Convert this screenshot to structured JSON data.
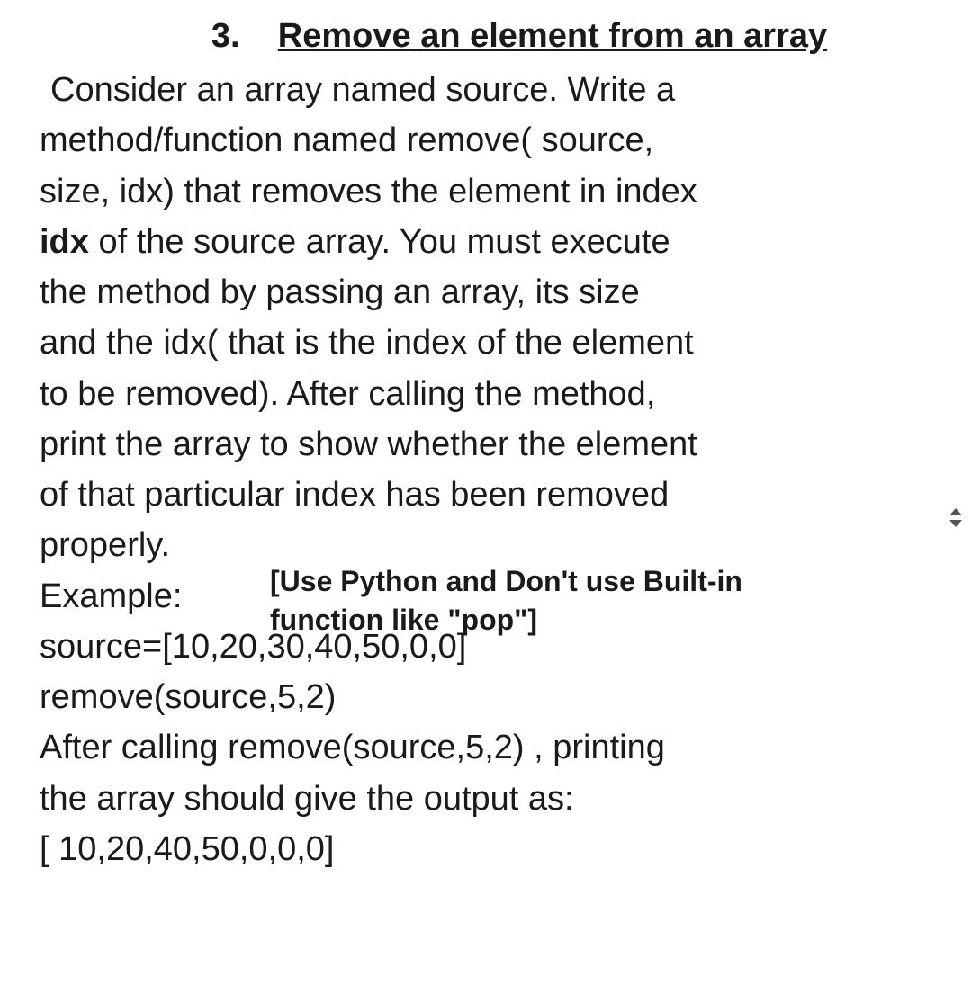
{
  "heading": {
    "number": "3.",
    "title": "Remove an element from an array"
  },
  "body": {
    "line1": "Consider an array named source. Write a",
    "line2": "method/function named remove( source,",
    "line3": "size, idx) that removes the element in index",
    "line4_prefix": "idx",
    "line4_rest": " of the source array. You must execute",
    "line5": "the method by passing an array, its size",
    "line6": "and the idx( that is the index of the element",
    "line7": "to be removed). After calling the method,",
    "line8": "print the array to show whether the element",
    "line9": "of that particular index has been removed",
    "line10": "properly.",
    "line11": "Example:",
    "line12": "source=[10,20,30,40,50,0,0]",
    "line13": "remove(source,5,2)",
    "line14": "After calling remove(source,5,2) , printing",
    "line15": "the array should give the output as:",
    "line16": " [ 10,20,40,50,0,0,0]"
  },
  "note": {
    "line1": "[Use Python and Don't use Built-in",
    "line2": "function like \"pop\"]"
  }
}
